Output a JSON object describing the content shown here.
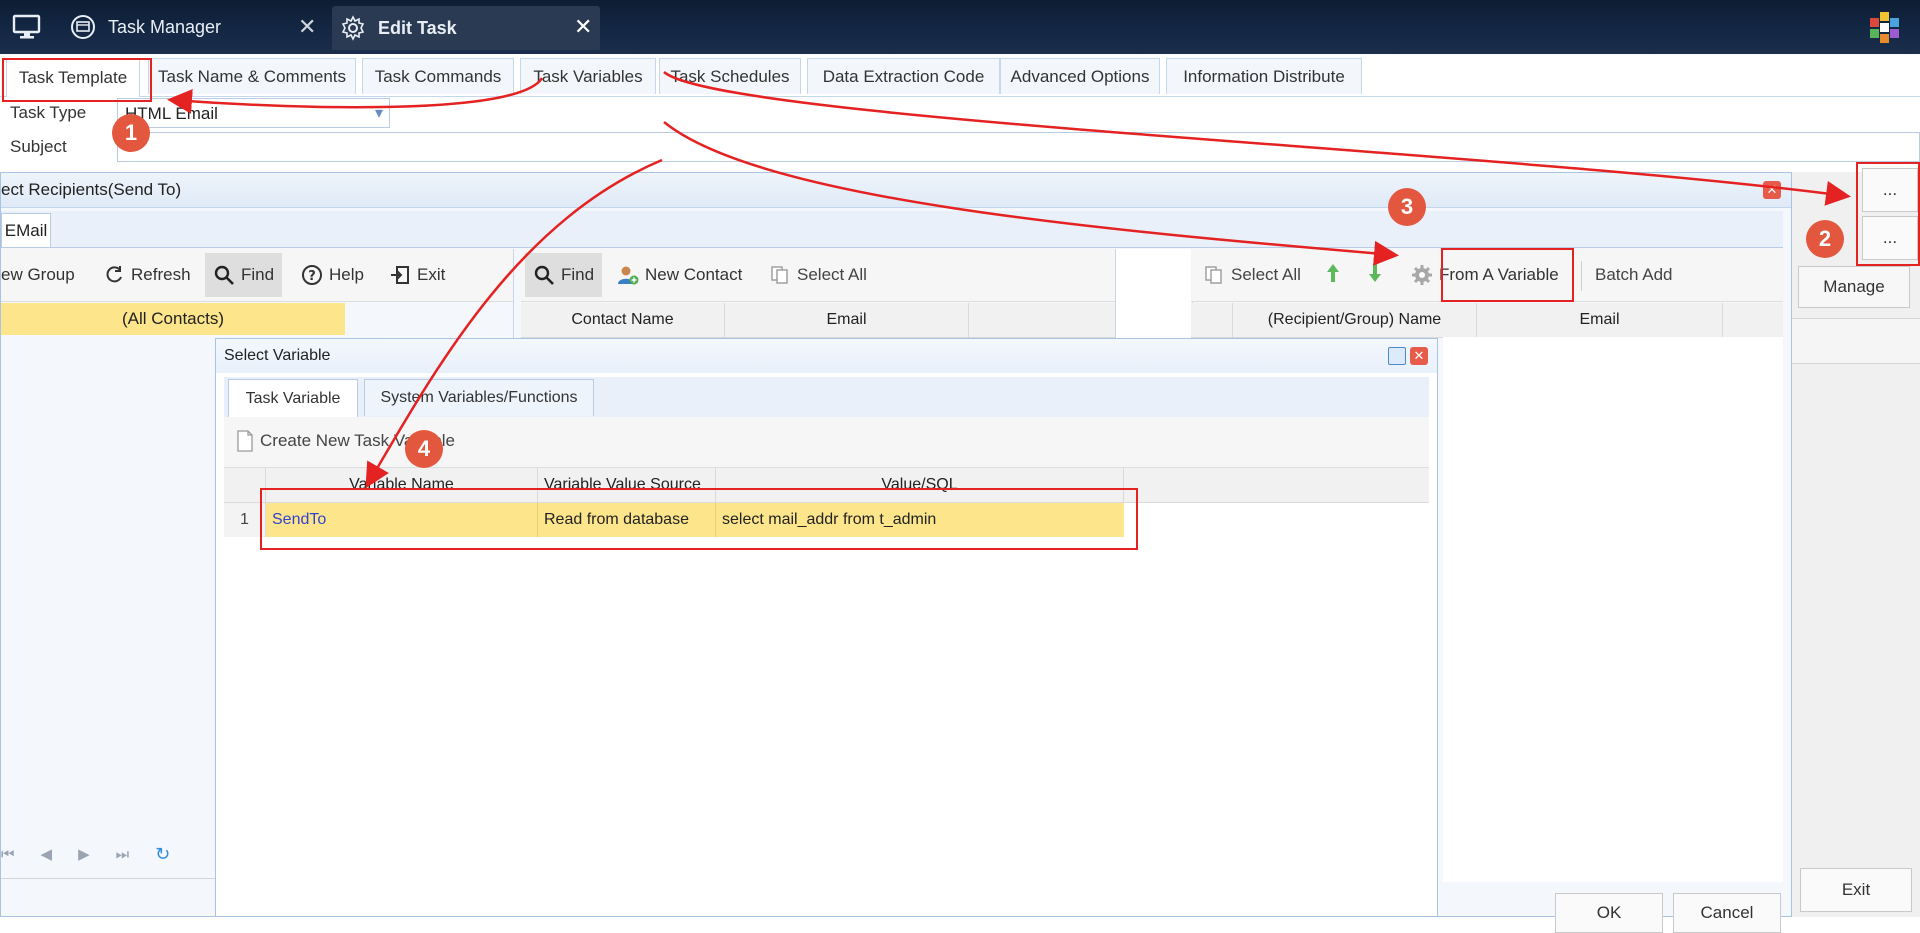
{
  "topbar": {
    "tabs": [
      {
        "label": "Task Manager",
        "icon": "window-icon"
      },
      {
        "label": "Edit Task",
        "icon": "gear-icon"
      }
    ]
  },
  "main_tabs": [
    "Task Template",
    "Task Name & Comments",
    "Task Commands",
    "Task Variables",
    "Task Schedules",
    "Data Extraction Code",
    "Advanced Options",
    "Information Distribute"
  ],
  "form": {
    "task_type_label": "Task Type",
    "task_type_value": "HTML Email",
    "subject_label": "Subject",
    "subject_value": ""
  },
  "side_buttons": {
    "browse1": "...",
    "browse2": "...",
    "manage": "Manage",
    "exit": "Exit"
  },
  "recipients_dialog": {
    "title": "ect Recipients(Send To)",
    "tab": "EMail",
    "left_toolbar": [
      "ew Group",
      "Refresh",
      "Find",
      "Help",
      "Exit"
    ],
    "group_row": "(All Contacts)",
    "middle_toolbar": [
      "Find",
      "New Contact",
      "Select All"
    ],
    "middle_columns": [
      "Contact Name",
      "Email"
    ],
    "right_toolbar": [
      "Select All",
      "From A Variable",
      "Batch Add"
    ],
    "right_columns": [
      "(Recipient/Group) Name",
      "Email"
    ],
    "buttons": {
      "ok": "OK",
      "cancel": "Cancel"
    }
  },
  "select_variable_dialog": {
    "title": "Select Variable",
    "tabs": [
      "Task Variable",
      "System Variables/Functions"
    ],
    "create_label": "Create New Task Variable",
    "columns": [
      "Variable Name",
      "Variable Value Source",
      "Value/SQL"
    ],
    "rows": [
      {
        "num": "1",
        "name": "SendTo",
        "source": "Read from database",
        "value": "select mail_addr from t_admin"
      }
    ]
  },
  "markers": [
    "1",
    "2",
    "3",
    "4"
  ],
  "colors": {
    "topbar": "#142845",
    "annotation_red": "#e52222",
    "marker": "#e2573e",
    "selected_row": "#fde58c",
    "link_text": "#3344cc"
  }
}
